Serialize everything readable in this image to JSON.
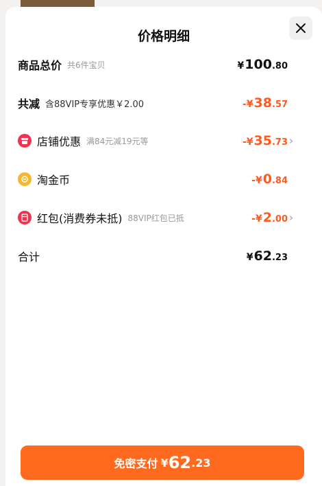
{
  "sheet": {
    "title": "价格明细",
    "close_icon": "close-icon"
  },
  "rows": {
    "total_goods": {
      "label": "商品总价",
      "sub": "共6件宝贝",
      "currency": "¥",
      "amount_int": "100",
      "amount_dec": ".80"
    },
    "total_discount": {
      "label": "共减",
      "sub": "含88VIP专享优惠￥2.00",
      "sign": "-¥",
      "amount_int": "38",
      "amount_dec": ".57"
    },
    "shop_discount": {
      "icon": "shop-icon",
      "label": "店铺优惠",
      "sub": "满84元减19元等",
      "sign": "-¥",
      "amount_int": "35",
      "amount_dec": ".73"
    },
    "taojinbi": {
      "icon": "coin-icon",
      "label": "淘金币",
      "sign": "-¥",
      "amount_int": "0",
      "amount_dec": ".84"
    },
    "red_packet": {
      "icon": "red-packet-icon",
      "label": "红包(消费券未抵)",
      "sub": "88VIP红包已抵",
      "sign": "-¥",
      "amount_int": "2",
      "amount_dec": ".00"
    },
    "subtotal": {
      "label": "合计",
      "currency": "¥",
      "amount_int": "62",
      "amount_dec": ".23"
    }
  },
  "pay_button": {
    "label": "免密支付",
    "currency": "¥",
    "amount_int": "62",
    "amount_dec": ".23"
  },
  "colors": {
    "accent": "#ff6a1f",
    "discount_text": "#ff5a1f",
    "shop_icon": "#f2334f",
    "coin_icon": "#f5b72e"
  }
}
